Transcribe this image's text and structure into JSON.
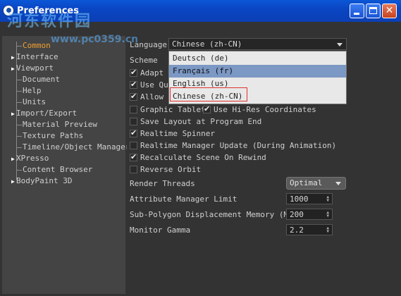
{
  "window": {
    "title": "Preferences",
    "watermark_text": "河东软件园",
    "watermark_url": "www.pc0359.cn"
  },
  "colors": {
    "titlebar": "#0a50d0",
    "panel_bg": "#333333",
    "tree_bg": "#444444",
    "selected_text": "#f0a030",
    "highlight": "#7c98c4",
    "annotation_red": "#e0322c"
  },
  "sidebar": {
    "items": [
      {
        "label": "Common",
        "expandable": false,
        "selected": true
      },
      {
        "label": "Interface",
        "expandable": true
      },
      {
        "label": "Viewport",
        "expandable": true
      },
      {
        "label": "Document",
        "expandable": false
      },
      {
        "label": "Help",
        "expandable": false
      },
      {
        "label": "Units",
        "expandable": false
      },
      {
        "label": "Import/Export",
        "expandable": true
      },
      {
        "label": "Material Preview",
        "expandable": false
      },
      {
        "label": "Texture Paths",
        "expandable": false
      },
      {
        "label": "Timeline/Object Manager",
        "expandable": false
      },
      {
        "label": "XPresso",
        "expandable": true
      },
      {
        "label": "Content Browser",
        "expandable": false
      },
      {
        "label": "BodyPaint 3D",
        "expandable": true
      }
    ]
  },
  "main": {
    "language_label": "Language",
    "language_value": "Chinese (zh-CN)",
    "scheme_label": "Scheme",
    "partial_options": [
      {
        "label": "Adapt ",
        "checked": true
      },
      {
        "label": "Use Qu",
        "checked": true
      },
      {
        "label": "Allow ",
        "checked": true
      }
    ],
    "graphic_tablet": {
      "label": "Graphic Tablet",
      "checked": false
    },
    "hi_res": {
      "label": "Use Hi-Res Coordinates",
      "checked": true
    },
    "options": [
      {
        "label": "Save Layout at Program End",
        "checked": false
      },
      {
        "label": "Realtime Spinner",
        "checked": true
      },
      {
        "label": "Realtime Manager Update (During Animation)",
        "checked": false
      },
      {
        "label": "Recalculate Scene On Rewind",
        "checked": true
      },
      {
        "label": "Reverse Orbit",
        "checked": false
      }
    ],
    "render_threads": {
      "label": "Render Threads",
      "value": "Optimal"
    },
    "attr_limit": {
      "label": "Attribute Manager Limit",
      "value": "1000"
    },
    "subpoly": {
      "label": "Sub-Polygon Displacement Memory (MB)",
      "value": "200"
    },
    "gamma": {
      "label": "Monitor Gamma",
      "value": "2.2"
    }
  },
  "language_popup": {
    "items": [
      {
        "label": "Deutsch (de)"
      },
      {
        "label": "Français (fr)",
        "highlighted": true
      },
      {
        "label": "English (us)"
      },
      {
        "label": "Chinese (zh-CN)",
        "annotated": true
      }
    ]
  }
}
